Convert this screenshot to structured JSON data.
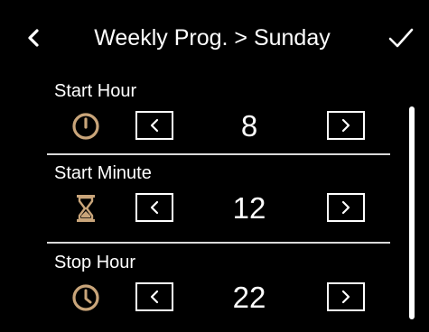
{
  "header": {
    "title": "Weekly Prog. > Sunday",
    "back_icon": "chevron-left-icon",
    "confirm_icon": "checkmark-icon"
  },
  "settings": [
    {
      "label": "Start Hour",
      "value": "8",
      "icon": "timer-icon"
    },
    {
      "label": "Start Minute",
      "value": "12",
      "icon": "hourglass-icon"
    },
    {
      "label": "Stop Hour",
      "value": "22",
      "icon": "clock-icon"
    }
  ],
  "colors": {
    "background": "#000000",
    "text": "#ffffff",
    "icon_accent": "#c9a57a",
    "divider": "#d9d9d9"
  }
}
